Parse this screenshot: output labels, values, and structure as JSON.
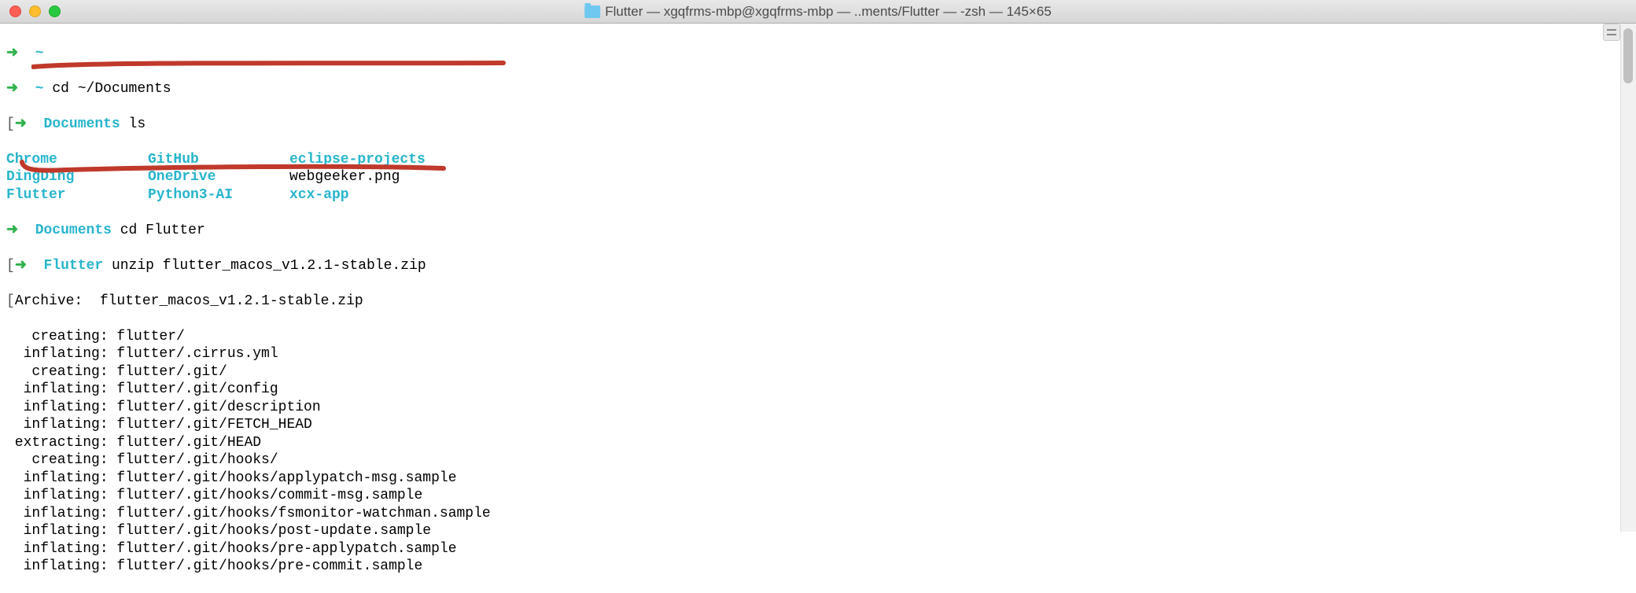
{
  "titlebar": {
    "title": "Flutter — xgqfrms-mbp@xgqfrms-mbp — ..ments/Flutter — -zsh — 145×65"
  },
  "prompt": {
    "arrow": "➜",
    "home": "~",
    "docs": "Documents",
    "flutter": "Flutter"
  },
  "cmd": {
    "cd_docs": "cd ~/Documents",
    "ls": "ls",
    "cd_flutter": "cd Flutter",
    "unzip": "unzip flutter_macos_v1.2.1-stable.zip"
  },
  "ls": {
    "r0c0": "Chrome",
    "r0c1": "GitHub",
    "r0c2": "eclipse-projects",
    "r1c0": "DingDing",
    "r1c1": "OneDrive",
    "r1c2": "webgeeker.png",
    "r2c0": "Flutter",
    "r2c1": "Python3-AI",
    "r2c2": "xcx-app"
  },
  "unzip": {
    "archive": "Archive:  flutter_macos_v1.2.1-stable.zip",
    "lines": [
      "   creating: flutter/",
      "  inflating: flutter/.cirrus.yml",
      "   creating: flutter/.git/",
      "  inflating: flutter/.git/config",
      "  inflating: flutter/.git/description",
      "  inflating: flutter/.git/FETCH_HEAD",
      " extracting: flutter/.git/HEAD",
      "   creating: flutter/.git/hooks/",
      "  inflating: flutter/.git/hooks/applypatch-msg.sample",
      "  inflating: flutter/.git/hooks/commit-msg.sample",
      "  inflating: flutter/.git/hooks/fsmonitor-watchman.sample",
      "  inflating: flutter/.git/hooks/post-update.sample",
      "  inflating: flutter/.git/hooks/pre-applypatch.sample",
      "  inflating: flutter/.git/hooks/pre-commit.sample"
    ]
  }
}
